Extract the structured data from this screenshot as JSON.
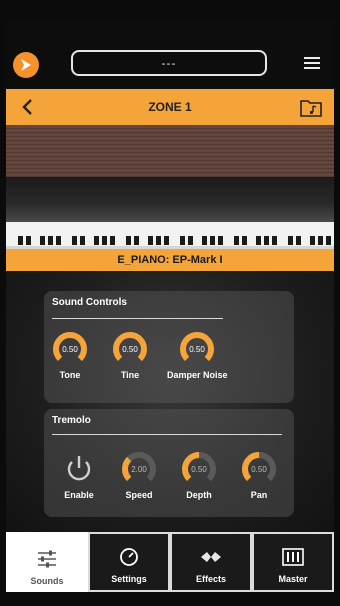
{
  "header": {
    "title_value": "---"
  },
  "zone": {
    "title": "ZONE 1"
  },
  "preset": {
    "name": "E_PIANO: EP-Mark I"
  },
  "sound_controls": {
    "title": "Sound Controls",
    "knobs": [
      {
        "label": "Tone",
        "value": "0.50"
      },
      {
        "label": "Tine",
        "value": "0.50"
      },
      {
        "label": "Damper Noise",
        "value": "0.50"
      }
    ]
  },
  "tremolo": {
    "title": "Tremolo",
    "enable_label": "Enable",
    "knobs": [
      {
        "label": "Speed",
        "value": "2.00"
      },
      {
        "label": "Depth",
        "value": "0.50"
      },
      {
        "label": "Pan",
        "value": "0.50"
      }
    ]
  },
  "tabs": [
    {
      "label": "Sounds",
      "icon": "sliders-icon",
      "active": true
    },
    {
      "label": "Settings",
      "icon": "gauge-icon",
      "active": false
    },
    {
      "label": "Effects",
      "icon": "effects-icon",
      "active": false
    },
    {
      "label": "Master",
      "icon": "mixer-icon",
      "active": false
    }
  ],
  "colors": {
    "accent": "#f5a43a",
    "logo": "#f5922b",
    "knob_active": "#f5a43a",
    "knob_inactive": "#5a5a5a"
  }
}
